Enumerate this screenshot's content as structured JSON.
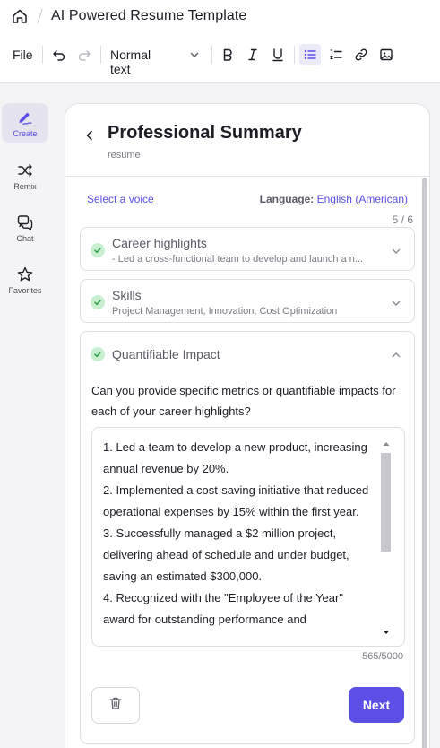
{
  "header": {
    "doc_title": "AI Powered Resume Template"
  },
  "toolbar": {
    "file_label": "File",
    "text_style": "Normal text",
    "icons": [
      "undo-icon",
      "redo-icon",
      "bold-icon",
      "italic-icon",
      "underline-icon",
      "bullet-list-icon",
      "numbered-list-icon",
      "link-icon",
      "image-icon"
    ],
    "active": "bullet-list-icon"
  },
  "rail": {
    "items": [
      {
        "label": "Create",
        "icon": "pen-squiggle-icon",
        "active": true
      },
      {
        "label": "Remix",
        "icon": "shuffle-icon",
        "active": false
      },
      {
        "label": "Chat",
        "icon": "chat-bubbles-icon",
        "active": false
      },
      {
        "label": "Favorites",
        "icon": "star-icon",
        "active": false
      }
    ]
  },
  "panel": {
    "title": "Professional Summary",
    "subtitle": "resume",
    "voice_link": "Select a voice",
    "language_label": "Language:",
    "language_value": "English (American)",
    "progress": "5 / 6",
    "sections": [
      {
        "title": "Career highlights",
        "summary": "- Led a cross-functional team to develop and launch a n...",
        "completed": true,
        "expanded": false
      },
      {
        "title": "Skills",
        "summary": "Project Management, Innovation, Cost Optimization",
        "completed": true,
        "expanded": false
      },
      {
        "title": "Quantifiable Impact",
        "summary": "",
        "completed": true,
        "expanded": true
      }
    ],
    "question": "Can you provide specific metrics or quantifiable impacts for each of your career highlights?",
    "answer": "1. Led a team to develop a new product, increasing annual revenue by 20%.\n2. Implemented a cost-saving initiative that reduced operational expenses by 15% within the first year.\n3. Successfully managed a $2 million project, delivering ahead of schedule and under budget, saving an estimated $300,000.\n4. Recognized with the \"Employee of the Year\" award for outstanding performance and",
    "char_count": "565/5000",
    "next_label": "Next"
  },
  "colors": {
    "accent": "#5b4fe6",
    "check_bg": "#c8f0d0",
    "check_fg": "#2e9e4a"
  }
}
